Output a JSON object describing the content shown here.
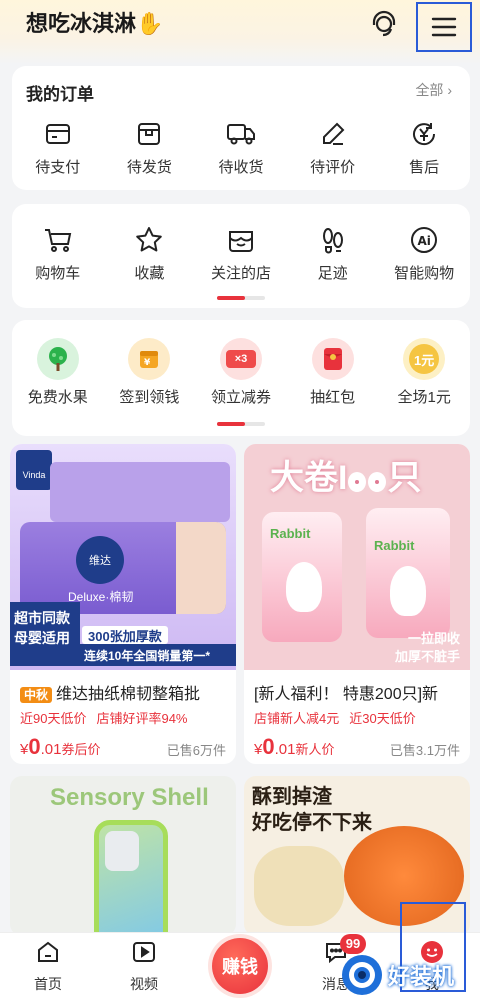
{
  "header": {
    "username": "想吃冰淇淋",
    "emoji": "✋"
  },
  "orders": {
    "title": "我的订单",
    "all_label": "全部",
    "items": [
      {
        "label": "待支付",
        "icon": "wallet-icon"
      },
      {
        "label": "待发货",
        "icon": "box-icon"
      },
      {
        "label": "待收货",
        "icon": "truck-icon"
      },
      {
        "label": "待评价",
        "icon": "pen-icon"
      },
      {
        "label": "售后",
        "icon": "yuan-return-icon"
      }
    ]
  },
  "tools": {
    "items": [
      {
        "label": "购物车",
        "icon": "cart-icon"
      },
      {
        "label": "收藏",
        "icon": "star-icon"
      },
      {
        "label": "关注的店",
        "icon": "shop-icon"
      },
      {
        "label": "足迹",
        "icon": "footprint-icon"
      },
      {
        "label": "智能购物",
        "icon": "ai-icon"
      }
    ]
  },
  "promos": {
    "items": [
      {
        "label": "免费水果",
        "icon": "tree-icon",
        "color": "#2bb24c"
      },
      {
        "label": "签到领钱",
        "icon": "calendar-coin-icon",
        "color": "#f5a623"
      },
      {
        "label": "领立减券",
        "icon": "coupon-icon",
        "color": "#ef4b4b",
        "badge": "×3"
      },
      {
        "label": "抽红包",
        "icon": "red-envelope-icon",
        "color": "#e8323c"
      },
      {
        "label": "全场1元",
        "icon": "coin-icon",
        "color": "#f5c542",
        "badge": "1元"
      }
    ]
  },
  "products": [
    {
      "badge": "中秋",
      "title": "维达抽纸棉韧整箱批",
      "tags": [
        "近90天低价",
        "店铺好评率94%"
      ],
      "price_prefix": "¥",
      "price_big": "0",
      "price_small": ".01",
      "price_note": "券后价",
      "sold": "已售6万件",
      "image_text": {
        "brand": "Vinda",
        "brand_cn": "维达",
        "sub": "Deluxe·棉韧",
        "corner_1": "超市同款",
        "corner_2": "母婴适用",
        "banner_1": "300张加厚款",
        "banner_2": "连续10年全国销量第一*"
      }
    },
    {
      "badge": "",
      "title": "[新人福利！ 特惠200只]新",
      "tags": [
        "店铺新人减4元",
        "近30天低价"
      ],
      "price_prefix": "¥",
      "price_big": "0",
      "price_small": ".01",
      "price_note": "新人价",
      "sold": "已售3.1万件",
      "image_text": {
        "headline": "大卷I",
        "headline_2": "只",
        "brand": "Rabbit",
        "note_1": "一拉即收",
        "note_2": "加厚不脏手"
      }
    },
    {
      "image_text": {
        "headline": "Sensory Shell"
      }
    },
    {
      "image_text": {
        "line_1": "酥到掉渣",
        "line_2": "好吃停不下来"
      }
    }
  ],
  "tabbar": {
    "items": [
      {
        "label": "首页",
        "icon": "home-icon"
      },
      {
        "label": "视频",
        "icon": "video-icon"
      },
      {
        "label": "赚钱",
        "icon": "earn-icon"
      },
      {
        "label": "消息",
        "icon": "message-icon",
        "badge": "99"
      },
      {
        "label": "我",
        "icon": "me-icon"
      }
    ]
  },
  "watermark": {
    "text": "好装机"
  }
}
